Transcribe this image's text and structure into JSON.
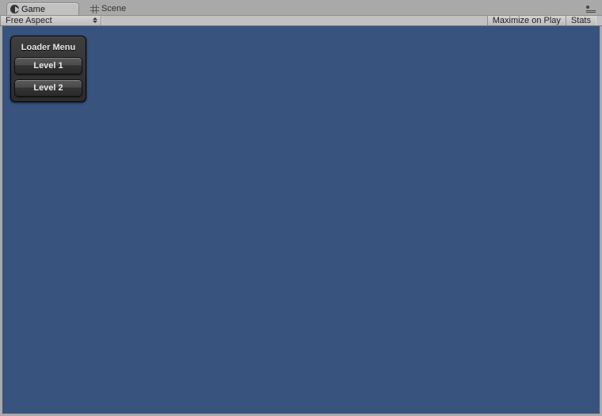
{
  "tabs": {
    "game": "Game",
    "scene": "Scene"
  },
  "controlbar": {
    "aspect": "Free Aspect",
    "maximize": "Maximize on Play",
    "stats": "Stats"
  },
  "loader": {
    "title": "Loader Menu",
    "level1": "Level 1",
    "level2": "Level 2"
  },
  "colors": {
    "viewport_bg": "#38547e"
  }
}
